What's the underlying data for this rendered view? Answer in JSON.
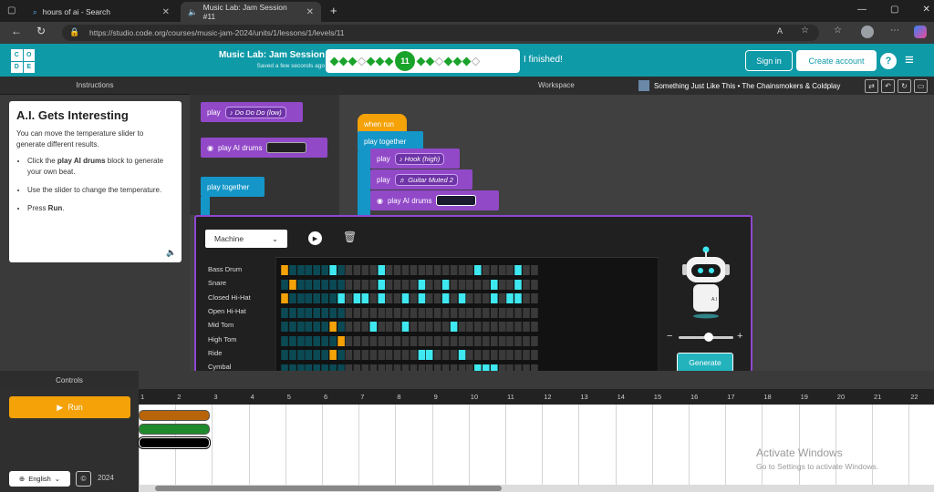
{
  "browser": {
    "tabs": [
      {
        "title": "hours of ai - Search",
        "icon": "search-icon"
      },
      {
        "title": "Music Lab: Jam Session #11",
        "icon": "speaker-icon"
      }
    ],
    "url": "https://studio.code.org/courses/music-jam-2024/units/1/lessons/1/levels/11"
  },
  "header": {
    "logo_letters": [
      "C",
      "O",
      "D",
      "E"
    ],
    "title": "Music Lab: Jam Session",
    "saved": "Saved a few seconds ago",
    "current_level": "11",
    "progress_states": [
      "done",
      "done",
      "done",
      "open",
      "done",
      "done",
      "done",
      "done",
      "done",
      "open",
      "done",
      "done",
      "done",
      "open"
    ],
    "finished_text": "I finished!",
    "sign_in": "Sign in",
    "create_account": "Create account",
    "help": "?"
  },
  "instructions": {
    "panel_title": "Instructions",
    "heading": "A.I. Gets Interesting",
    "intro": "You can move the temperature slider to generate different results.",
    "bullets": [
      {
        "pre": "Click the ",
        "bold": "play AI drums",
        "post": " block to generate your own beat."
      },
      {
        "pre": "Use the slider to change the temperature.",
        "bold": "",
        "post": ""
      },
      {
        "pre": "Press ",
        "bold": "Run",
        "post": "."
      }
    ]
  },
  "workspace": {
    "title": "Workspace",
    "song": "Something Just Like This • The Chainsmokers & Coldplay",
    "toolbox": {
      "play": "play",
      "sound_low": "Do Do Do (low)",
      "ai_drums": "play AI drums",
      "play_together": "play together"
    },
    "script": {
      "when_run": "when run",
      "play_together": "play together",
      "play": "play",
      "hook": "Hook (high)",
      "guitar": "Guitar Muted 2",
      "ai_drums": "play AI drums"
    }
  },
  "drum_editor": {
    "kit": "Machine",
    "instruments": [
      "Bass Drum",
      "Snare",
      "Closed Hi-Hat",
      "Open Hi-Hat",
      "Mid Tom",
      "High Tom",
      "Ride",
      "Cymbal"
    ],
    "pattern": [
      "1000000100020002",
      "0100000100002001",
      "1010000100000011",
      "0000000000000000",
      "0001000001020200",
      "0001000000000000",
      "0001000000000000",
      "0000000000000000"
    ],
    "pattern_full": [
      "o.....c.....c...........c....c..",
      ".o..........c....c..c.....c..c...",
      "o......c.cc.c..c.c..c.c...c.cc",
      "",
      "......o....c...c.....c..........",
      ".......o........................",
      "......o..........cc...c.........",
      "........................ccc....."
    ],
    "generate": "Generate",
    "slider": {
      "min_label": "−",
      "max_label": "+",
      "value": 0.55
    },
    "colors": {
      "on_orange": "#f4a208",
      "on_cyan": "#3ee8f0",
      "off_dark": "#0b4a55",
      "off_gray": "#3a3a3a"
    }
  },
  "controls": {
    "title": "Controls",
    "run": "Run",
    "language": "English",
    "year": "2024"
  },
  "timeline": {
    "measures": [
      "1",
      "2",
      "3",
      "4",
      "5",
      "6",
      "7",
      "8",
      "9",
      "10",
      "11",
      "12",
      "13",
      "14",
      "15",
      "16",
      "17",
      "18",
      "19",
      "20",
      "21",
      "22"
    ]
  },
  "watermark": {
    "line1": "Activate Windows",
    "line2": "Go to Settings to activate Windows."
  }
}
